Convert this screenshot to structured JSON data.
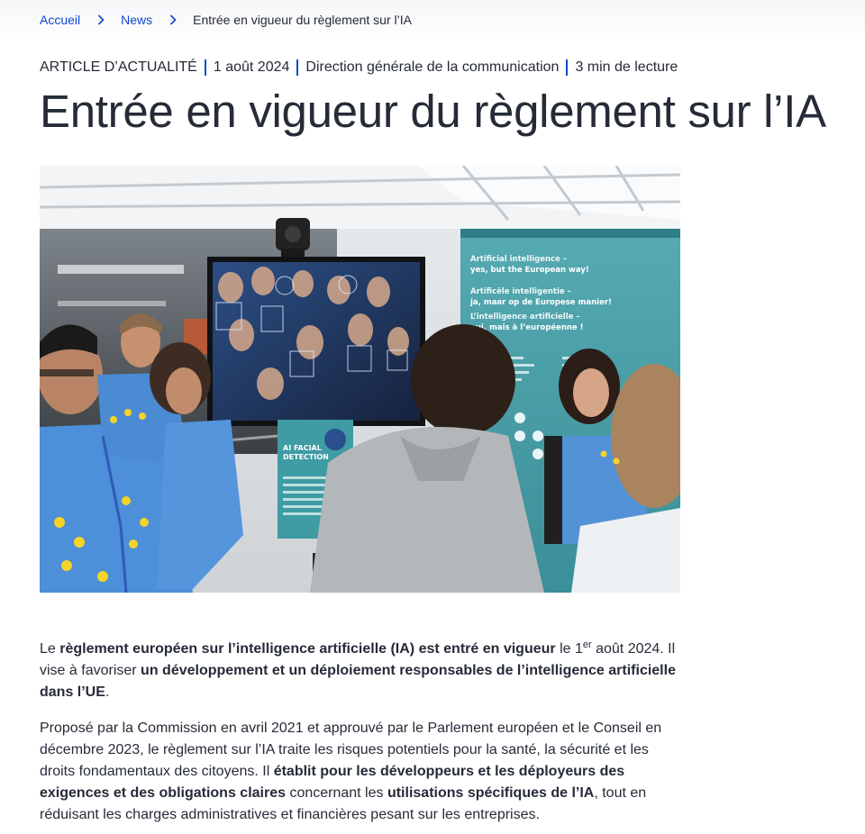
{
  "breadcrumb": {
    "home": "Accueil",
    "news": "News",
    "current": "Entrée en vigueur du règlement sur l’IA"
  },
  "meta": {
    "type": "ARTICLE D’ACTUALITÉ",
    "date": "1 août 2024",
    "author": "Direction générale de la communication",
    "read_time": "3 min de lecture"
  },
  "title": "Entrée en vigueur du règlement sur l’IA",
  "hero_panel": {
    "line1": "Artificial intelligence –",
    "line2": "yes, but the European way!",
    "line3": "Artificële intelligentie –",
    "line4": "ja, maar op de Europese manier!",
    "line5": "L’intelligence artificielle –",
    "line6": "oui, mais à l’européenne !",
    "poster_line1": "AI FACIAL",
    "poster_line2": "DETECTION"
  },
  "paragraph1": {
    "t1": "Le ",
    "b1": "règlement européen sur l’intelligence artificielle (IA) est entré en vigueur",
    "t2": " le 1",
    "sup": "er",
    "t3": " août 2024. Il vise à favoriser ",
    "b2": "un développement et un déploiement responsables de l’intelligence artificielle dans l’UE",
    "t4": "."
  },
  "paragraph2": {
    "t1": "Proposé par la Commission en avril 2021 et approuvé par le Parlement européen et le Conseil en décembre 2023, le règlement sur l’IA traite les risques potentiels pour la santé, la sécurité et les droits fondamentaux des citoyens. Il ",
    "b1": "établit pour les développeurs et les déployeurs des exigences et des obligations claires",
    "t2": " concernant les ",
    "b2": "utilisations spécifiques de l’IA",
    "t3": ", tout en réduisant les charges administratives et financières pesant sur les entreprises."
  },
  "colors": {
    "link": "#0e47cb",
    "text": "#262b38",
    "panel_teal": "#3e9aa3",
    "shirt_blue": "#4f8fd6",
    "star_yellow": "#f6d327"
  }
}
